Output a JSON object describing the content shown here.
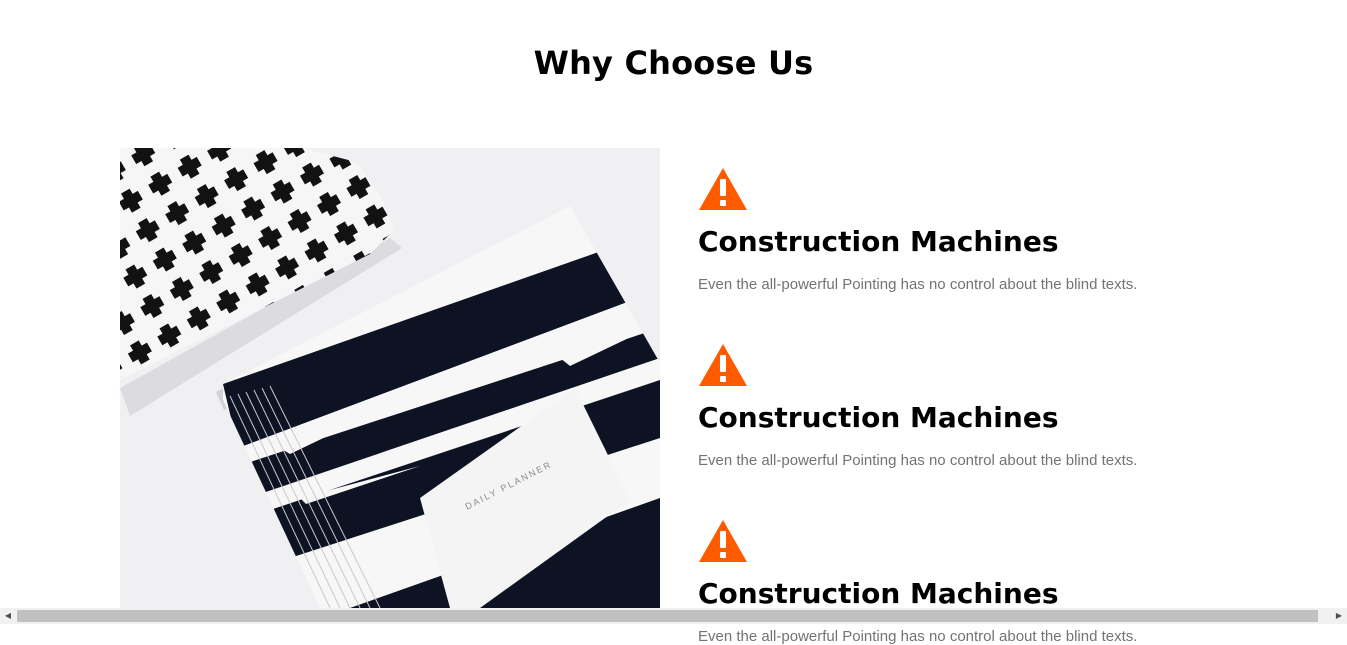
{
  "section": {
    "title": "Why Choose Us"
  },
  "image": {
    "planner_label": "DAILY PLANNER"
  },
  "features": [
    {
      "icon": "warning-icon",
      "title": "Construction Machines",
      "text": "Even the all-powerful Pointing has no control about the blind texts."
    },
    {
      "icon": "warning-icon",
      "title": "Construction Machines",
      "text": "Even the all-powerful Pointing has no control about the blind texts."
    },
    {
      "icon": "warning-icon",
      "title": "Construction Machines",
      "text": "Even the all-powerful Pointing has no control about the blind texts."
    }
  ],
  "colors": {
    "accent": "#ff5a00",
    "heading": "#000000",
    "body_text": "#737373"
  },
  "scrollbar": {
    "left_arrow_icon": "arrow-left-icon",
    "right_arrow_icon": "arrow-right-icon"
  }
}
